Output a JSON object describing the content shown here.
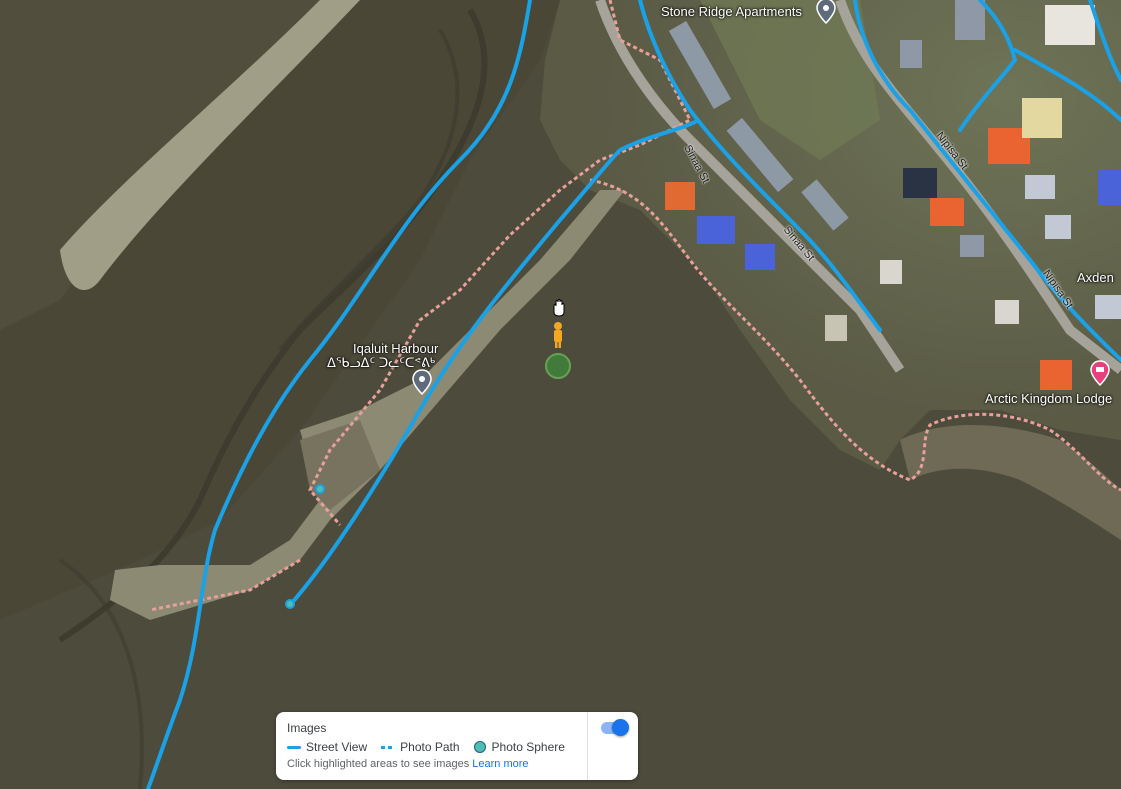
{
  "places": {
    "stone_ridge": "Stone Ridge Apartments",
    "iqaluit_harbour": "Iqaluit Harbour",
    "iqaluit_harbour_syllabics": "ᐃᖃᓗᐃᑦ ᑐᓚᑦᑕᕝᕕᒃ",
    "axden": "Axden",
    "arctic_kingdom": "Arctic Kingdom Lodge"
  },
  "streets": {
    "sinaa_st": "Sinaa St",
    "nipisa_st_upper": "Nipisa St",
    "nipisa_st_lower": "Nipisa St"
  },
  "legend": {
    "title": "Images",
    "street_view": "Street View",
    "photo_path": "Photo Path",
    "photo_sphere": "Photo Sphere",
    "hint": "Click highlighted areas to see images",
    "learn_more": "Learn more",
    "toggle_on": true
  },
  "colors": {
    "street_view_line": "#1aa1e6",
    "boundary_dashes": "#e8a09a",
    "hotel_pin": "#e8407a",
    "pegman": "#f5a623"
  },
  "icons": [
    "location-pin-icon",
    "hotel-pin-icon",
    "pegman-icon",
    "hand-cursor-icon",
    "photo-sphere-icon"
  ]
}
